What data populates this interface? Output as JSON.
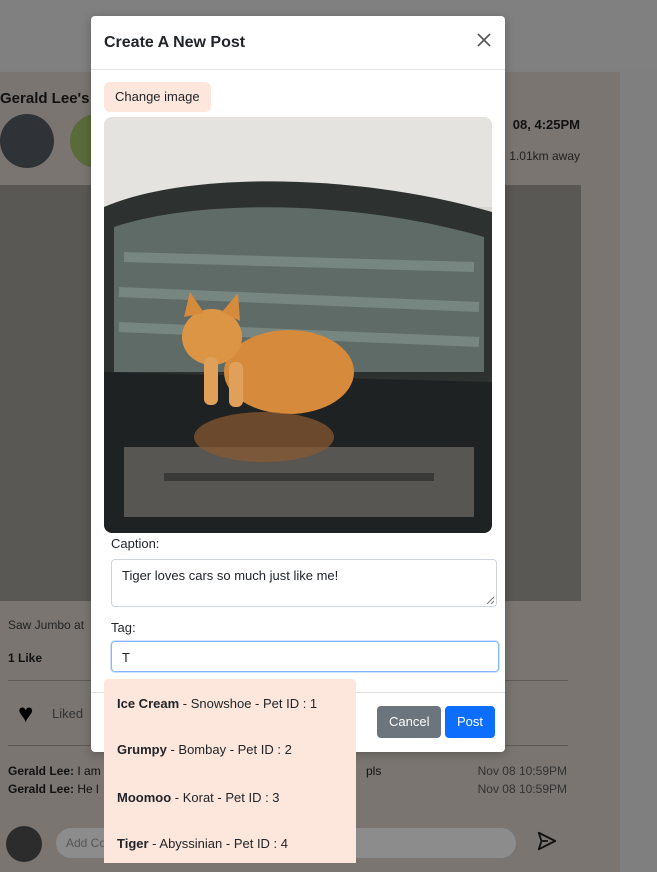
{
  "background": {
    "owner_label": "Gerald Lee's",
    "date": "08, 4:25PM",
    "distance": "1.01km away",
    "caption": "Saw Jumbo at",
    "likes": "1 Like",
    "liked_label": "Liked",
    "comments": [
      {
        "author": "Gerald Lee:",
        "text": "I am",
        "suffix": "pls",
        "time": "Nov 08 10:59PM"
      },
      {
        "author": "Gerald Lee:",
        "text": "He l",
        "suffix": "",
        "time": "Nov 08 10:59PM"
      }
    ],
    "add_comment_placeholder": "Add Co"
  },
  "modal": {
    "title": "Create A New Post",
    "change_image_label": "Change image",
    "caption_label": "Caption:",
    "caption_value": "Tiger loves cars so much just like me!",
    "tag_label": "Tag:",
    "tag_value": "T",
    "cancel_label": "Cancel",
    "post_label": "Post"
  },
  "dropdown": {
    "items": [
      {
        "name": "Ice Cream",
        "detail": " - Snowshoe - Pet ID : 1"
      },
      {
        "name": "Grumpy",
        "detail": " - Bombay - Pet ID : 2"
      },
      {
        "name": "Moomoo",
        "detail": " - Korat - Pet ID : 3"
      },
      {
        "name": "Tiger",
        "detail": " - Abyssinian - Pet ID : 4"
      }
    ]
  },
  "icons": {
    "close": "close-icon",
    "heart": "heart-icon",
    "send": "send-icon"
  }
}
